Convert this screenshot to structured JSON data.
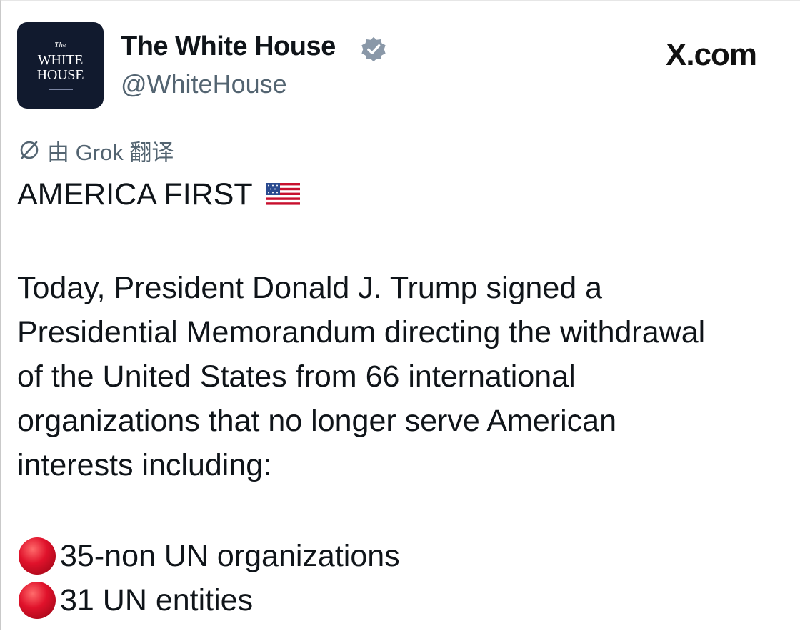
{
  "account": {
    "avatar": {
      "the": "The",
      "line1": "WHITE",
      "line2": "HOUSE"
    },
    "name": "The White House",
    "handle": "@WhiteHouse",
    "verified_icon": "verified-badge-icon"
  },
  "watermark": "X.com",
  "translation": {
    "icon": "globe-icon",
    "label": "由 Grok 翻译"
  },
  "post": {
    "headline": "AMERICA FIRST",
    "headline_emoji": "us-flag-icon",
    "body_lines": [
      "Today, President Donald J. Trump signed a",
      "Presidential Memorandum directing the withdrawal",
      "of the United States from 66 international",
      "organizations that no longer serve American",
      "interests including:"
    ],
    "bullets": [
      {
        "icon": "red-circle-icon",
        "text": "35-non UN organizations"
      },
      {
        "icon": "red-circle-icon",
        "text": "31 UN entities"
      }
    ]
  },
  "colors": {
    "text": "#0f1419",
    "secondary": "#536471",
    "verified": "#8a98a8",
    "avatar_bg": "#111a2e",
    "bullet": "#e0122b"
  }
}
